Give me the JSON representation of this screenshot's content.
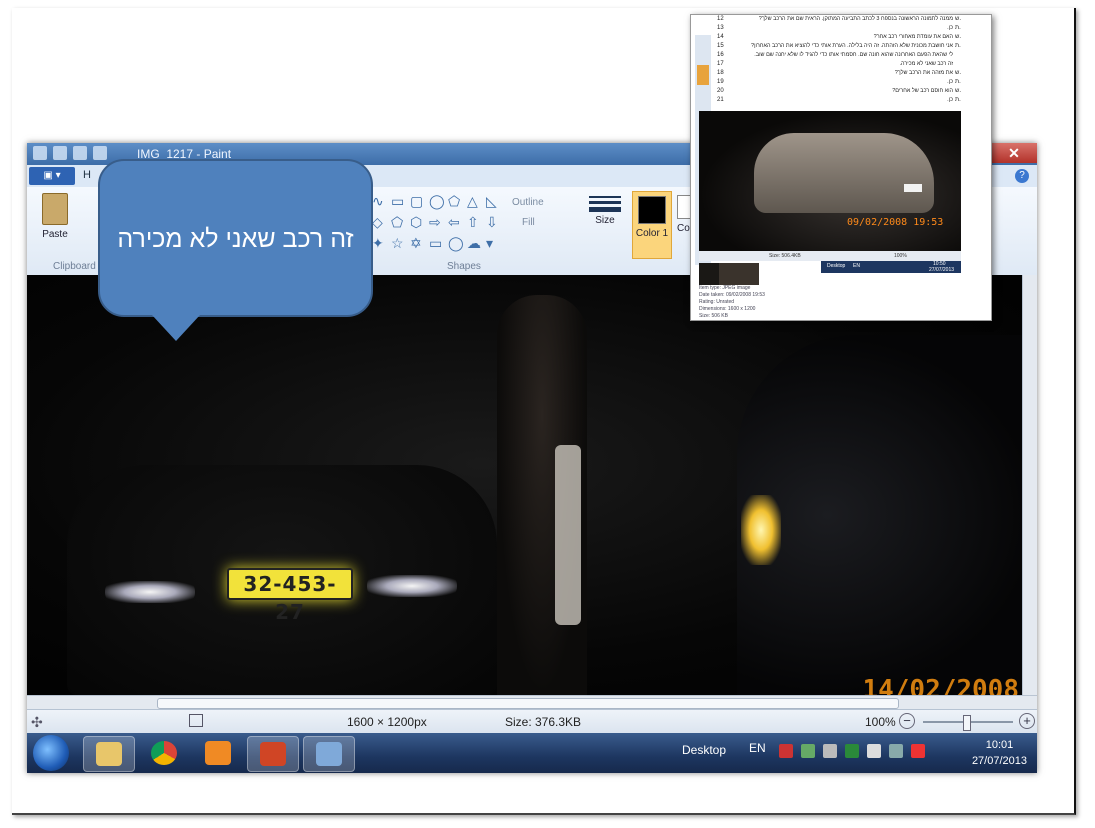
{
  "callout": {
    "text": "זה רכב שאני לא מכירה"
  },
  "paint": {
    "title": "IMG_1217 - Paint",
    "close_label": "✕",
    "file_label": "▣ ▾",
    "tab_home": "H",
    "help_label": "?",
    "ribbon": {
      "paste_label": "Paste",
      "clipboard_label": "Clipboard",
      "shapes_label": "Shapes",
      "outline_label": "Outline",
      "fill_label": "Fill",
      "size_label": "Size",
      "color1_label": "Color 1",
      "color2_label": "Co"
    },
    "photo": {
      "plate_text": "32-453-27",
      "date_stamp": "14/02/2008"
    },
    "status": {
      "dimensions": "1600 × 1200px",
      "size": "Size: 376.3KB",
      "zoom": "100%",
      "zoom_minus": "−",
      "zoom_plus": "+"
    }
  },
  "taskbar": {
    "desktop_label": "Desktop",
    "lang": "EN",
    "time": "10:01",
    "date": "27/07/2013"
  },
  "inset": {
    "lines": [
      {
        "num": "12",
        "spk": "ש.",
        "text": "ממנה לתמונה הראשונה בנספח 3 לכתב התביעה המתוקן. הראית שם את הרכב שלך?"
      },
      {
        "num": "13",
        "spk": "ת.",
        "text": "כן."
      },
      {
        "num": "14",
        "spk": "ש.",
        "text": "האם את עומדת מאחורי רכב אחר?"
      },
      {
        "num": "15",
        "spk": "ת.",
        "text": "אני חושבת מכונית שלא הזהתה. זה היה בלילה. הערת אותי כדי להוציא את הרכב האחרון?"
      },
      {
        "num": "16",
        "spk": "",
        "text": "לי שהאת הפעם האחרונה שהוא חונה שם. חסמתי אותו כדי להגיד לו שלא יחנה שם שוב."
      },
      {
        "num": "17",
        "spk": "",
        "text": "זה רכב שאני לא מכירה."
      },
      {
        "num": "18",
        "spk": "ש.",
        "text": "את מזהה את הרכב שלך?"
      },
      {
        "num": "19",
        "spk": "ת.",
        "text": "כן."
      },
      {
        "num": "20",
        "spk": "ש.",
        "text": "הוא חוסם רכב של אחרים?"
      },
      {
        "num": "21",
        "spk": "ת.",
        "text": "כן."
      }
    ],
    "photo_date": "09/02/2008 19:53",
    "status_size": "Size: 506.4KB",
    "status_zoom": "100%",
    "taskbar_desktop": "Desktop",
    "taskbar_lang": "EN",
    "taskbar_time": "10:50",
    "taskbar_date": "27/07/2013",
    "props": {
      "type": "Item type: JPEG image",
      "date_taken": "Date taken: 09/02/2008 19:53",
      "rating": "Rating: Unrated",
      "dimensions": "Dimensions: 1600 x 1200",
      "size": "Size: 506 KB"
    }
  }
}
